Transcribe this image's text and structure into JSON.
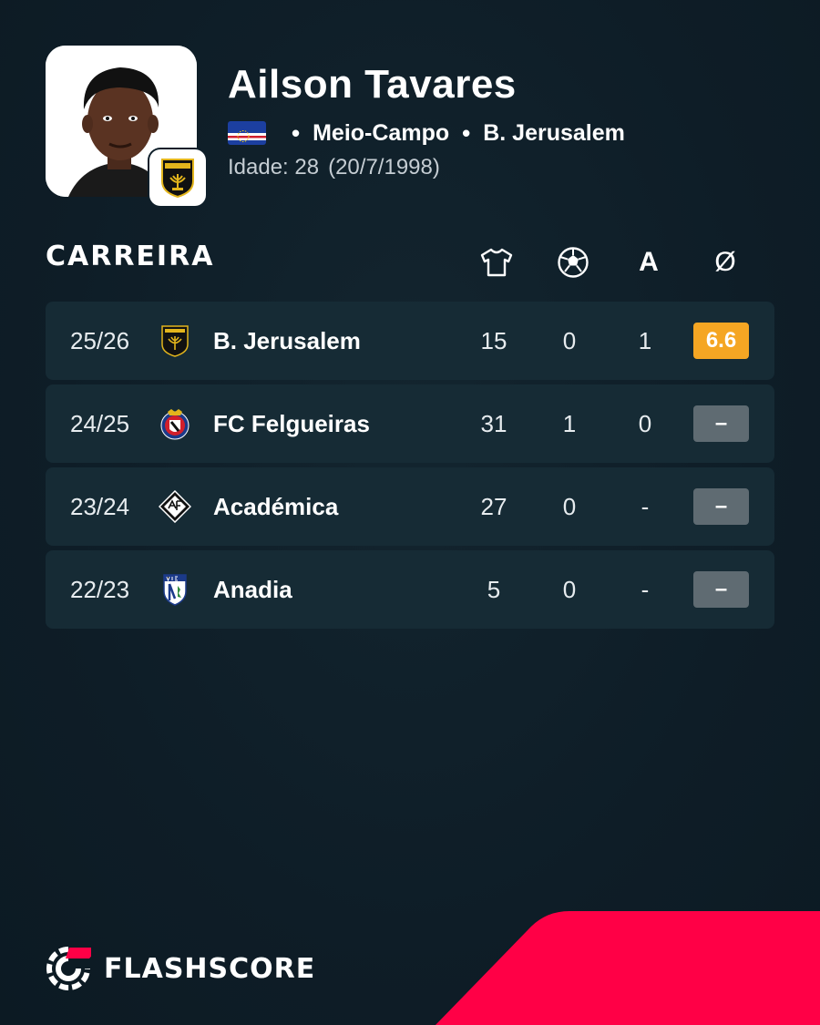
{
  "player": {
    "name": "Ailson Tavares",
    "position": "Meio-Campo",
    "club": "B. Jerusalem",
    "age_text": "Idade: 28",
    "birthdate": "(20/7/1998)",
    "flag_icon": "cape-verde-flag"
  },
  "career": {
    "title": "CARREIRA",
    "columns": [
      {
        "icon": "jersey-icon"
      },
      {
        "icon": "football-icon"
      },
      {
        "label": "A"
      },
      {
        "label": "Ø"
      }
    ],
    "rows": [
      {
        "season": "25/26",
        "team": "B. Jerusalem",
        "logo": "beitar-jerusalem-logo",
        "apps": "15",
        "goals": "0",
        "assists": "1",
        "rating": "6.6",
        "rating_color": "#f5a623"
      },
      {
        "season": "24/25",
        "team": "FC Felgueiras",
        "logo": "fc-felgueiras-logo",
        "apps": "31",
        "goals": "1",
        "assists": "0",
        "rating": "–",
        "rating_color": "#5f6b72"
      },
      {
        "season": "23/24",
        "team": "Académica",
        "logo": "academica-logo",
        "apps": "27",
        "goals": "0",
        "assists": "-",
        "rating": "–",
        "rating_color": "#5f6b72"
      },
      {
        "season": "22/23",
        "team": "Anadia",
        "logo": "anadia-logo",
        "apps": "5",
        "goals": "0",
        "assists": "-",
        "rating": "–",
        "rating_color": "#5f6b72"
      }
    ]
  },
  "brand": {
    "name": "FLASHSCORE",
    "accent": "#ff0046"
  }
}
